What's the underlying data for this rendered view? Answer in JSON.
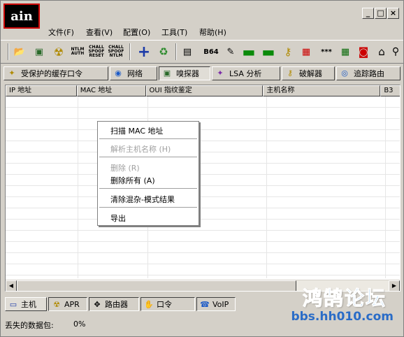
{
  "window": {
    "app_icon_text": "ain",
    "controls": [
      "_",
      "□",
      "×"
    ]
  },
  "menu": [
    {
      "label": "文件(F)"
    },
    {
      "label": "查看(V)"
    },
    {
      "label": "配置(O)"
    },
    {
      "label": "工具(T)"
    },
    {
      "label": "帮助(H)"
    }
  ],
  "toolbar": {
    "items": [
      {
        "name": "open-folder-icon",
        "glyph": "📂"
      },
      {
        "name": "sniffer-toggle-icon",
        "glyph": "▣"
      },
      {
        "name": "radiation-icon",
        "glyph": "☢"
      },
      {
        "name": "ntlm-auth-icon",
        "text": "NTLM AUTH"
      },
      {
        "name": "chall-spoof-reset-icon",
        "text": "CHALL SPOOF RESET"
      },
      {
        "name": "chall-spoof-ntlm-icon",
        "text": "CHALL SPOOF NTLM"
      },
      {
        "name": "add-icon",
        "glyph": "+"
      },
      {
        "name": "recycle-icon",
        "glyph": "♻"
      },
      {
        "name": "certificate-icon",
        "glyph": "▤"
      },
      {
        "name": "base64-icon",
        "text": "B64"
      },
      {
        "name": "decoder-icon",
        "glyph": "✎"
      },
      {
        "name": "wlan-icon",
        "glyph": "▬"
      },
      {
        "name": "vpn-icon",
        "glyph": "▬"
      },
      {
        "name": "key-icon",
        "glyph": "⚷"
      },
      {
        "name": "rdp-icon",
        "glyph": "▦"
      },
      {
        "name": "password-mask-icon",
        "text": "***"
      },
      {
        "name": "calculator-icon",
        "glyph": "▦"
      },
      {
        "name": "shield-icon",
        "glyph": "◙"
      },
      {
        "name": "house-icon",
        "glyph": "⌂"
      },
      {
        "name": "key-chain-icon",
        "glyph": "⚲"
      }
    ]
  },
  "tabs": [
    {
      "label": "受保护的缓存口令",
      "icon": "protected-storage-icon",
      "glyph": "✦"
    },
    {
      "label": "网络",
      "icon": "network-icon",
      "glyph": "◉"
    },
    {
      "label": "嗅探器",
      "icon": "sniffer-icon",
      "glyph": "▣"
    },
    {
      "label": "LSA 分析",
      "icon": "lsa-icon",
      "glyph": "✦"
    },
    {
      "label": "破解器",
      "icon": "cracker-icon",
      "glyph": "⚷"
    },
    {
      "label": "追踪路由",
      "icon": "traceroute-icon",
      "glyph": "◎"
    }
  ],
  "columns": [
    {
      "label": "IP 地址"
    },
    {
      "label": "MAC 地址"
    },
    {
      "label": "OUI 指纹鉴定"
    },
    {
      "label": "主机名称"
    },
    {
      "label": "B3"
    }
  ],
  "context_menu": [
    {
      "label": "扫描 MAC 地址",
      "enabled": true
    },
    {
      "label": "解析主机名称 (H)",
      "enabled": false
    },
    {
      "label": "删除 (R)",
      "enabled": false
    },
    {
      "label": "删除所有 (A)",
      "enabled": true
    },
    {
      "label": "清除混杂-模式结果",
      "enabled": true
    },
    {
      "label": "导出",
      "enabled": true
    }
  ],
  "bottom_tabs": [
    {
      "label": "主机",
      "glyph": "▭"
    },
    {
      "label": "APR",
      "glyph": "☢"
    },
    {
      "label": "路由器",
      "glyph": "✥"
    },
    {
      "label": "口令",
      "glyph": "✋"
    },
    {
      "label": "VoIP",
      "glyph": "☎"
    }
  ],
  "status": {
    "label": "丢失的数据包:",
    "value": "0%"
  },
  "watermark": {
    "line1": "鸿鹄论坛",
    "line2": "bbs.hh010.com"
  }
}
